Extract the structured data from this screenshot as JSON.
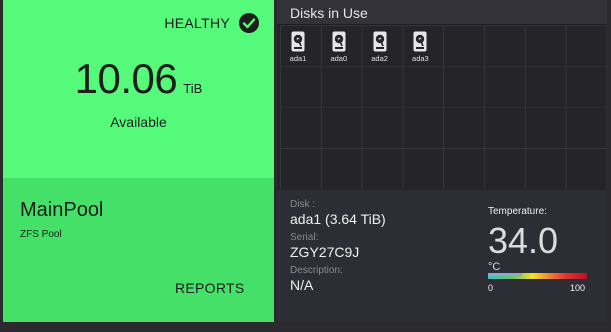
{
  "pool": {
    "status": "HEALTHY",
    "capacity_value": "10.06",
    "capacity_unit": "TiB",
    "available_label": "Available",
    "name": "MainPool",
    "type": "ZFS Pool",
    "reports_label": "REPORTS",
    "card_color": "#55fa7a",
    "card_color_bottom": "#44e067"
  },
  "disks_panel": {
    "title": "Disks in Use",
    "disks": [
      {
        "label": "ada1",
        "icon": "hard-drive-icon"
      },
      {
        "label": "ada0",
        "icon": "hard-drive-icon"
      },
      {
        "label": "ada2",
        "icon": "hard-drive-icon"
      },
      {
        "label": "ada3",
        "icon": "hard-drive-icon"
      }
    ],
    "details": {
      "disk_label": "Disk :",
      "disk_value": "ada1 (3.64 TiB)",
      "serial_label": "Serial:",
      "serial_value": "ZGY27C9J",
      "description_label": "Description:",
      "description_value": "N/A"
    },
    "temperature": {
      "label": "Temperature:",
      "value": "34.0",
      "unit": "°C",
      "scale_min": "0",
      "scale_max": "100",
      "level_fraction": 0.34
    }
  }
}
